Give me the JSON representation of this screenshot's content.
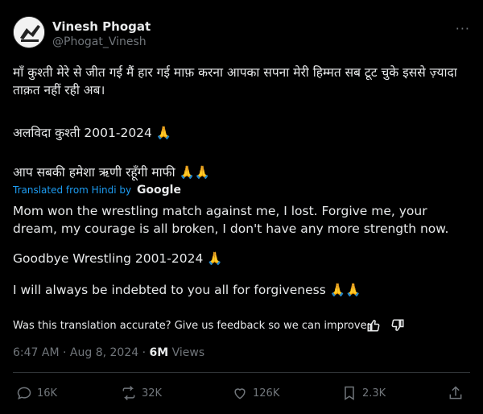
{
  "author": {
    "name": "Vinesh Phogat",
    "handle": "@Phogat_Vinesh"
  },
  "more_label": "···",
  "original_text": {
    "line1": "माँ कुश्ती मेरे से जीत गई मैं हार गई माफ़ करना आपका सपना मेरी हिम्मत सब टूट चुके इससे ज़्यादा ताक़त नहीं रही अब।",
    "line2": "अलविदा कुश्ती 2001-2024 🙏",
    "line3": "आप सबकी हमेशा ऋणी रहूँगी माफी 🙏🙏"
  },
  "translation": {
    "prefix": "Translated from Hindi by",
    "provider": "Google",
    "line1": "Mom won the wrestling match against me, I lost. Forgive me, your dream, my courage is all broken, I don't have any more strength now.",
    "line2": "Goodbye Wrestling 2001-2024 🙏",
    "line3": "I will always be indebted to you all for forgiveness 🙏🙏",
    "feedback": "Was this translation accurate? Give us feedback so we can improve:"
  },
  "meta": {
    "time": "6:47 AM",
    "separator": "·",
    "date": "Aug 8, 2024",
    "views_count": "6M",
    "views_label": "Views"
  },
  "actions": {
    "replies": "16K",
    "reposts": "32K",
    "likes": "126K",
    "bookmarks": "2.3K"
  },
  "colors": {
    "background": "#000000",
    "text": "#e7e9ea",
    "muted": "#71767b",
    "link": "#1d9bf0",
    "divider": "#2f3336"
  }
}
